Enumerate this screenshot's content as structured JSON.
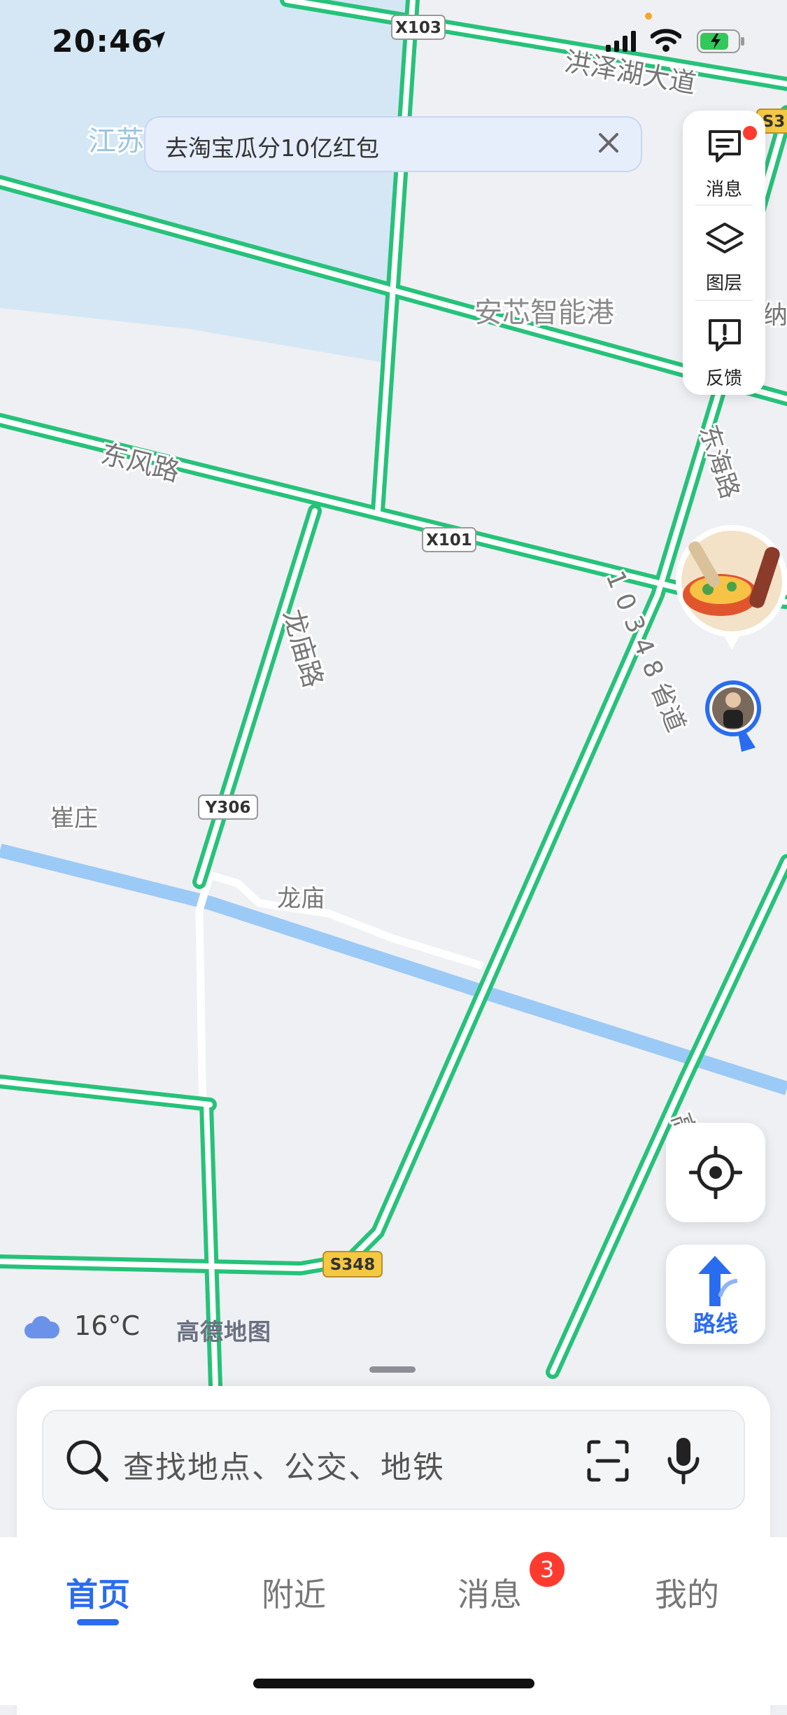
{
  "status_bar": {
    "time": "20:46"
  },
  "banner": {
    "text": "去淘宝瓜分10亿红包"
  },
  "side_panel": {
    "messages": "消息",
    "layers": "图层",
    "feedback": "反馈"
  },
  "map": {
    "labels": {
      "jiangsu": "江苏",
      "hongzehu": "洪泽湖大道",
      "anxin": "安芯智能港",
      "dongfeng": "东风路",
      "donghai": "东海路",
      "longmiao_road": "龙庙路",
      "provincial": "1 0 3 4 8 省道",
      "cuizhuang": "崔庄",
      "longmiao": "龙庙",
      "highway": "高速",
      "edge_fragment": "纳东"
    },
    "shields": {
      "x103": "X103",
      "x101": "X101",
      "y306": "Y306",
      "s348": "S348",
      "s3": "S3"
    }
  },
  "route_button": {
    "label": "路线"
  },
  "weather": {
    "temp": "16°C",
    "logo": "高德地图"
  },
  "search": {
    "placeholder": "查找地点、公交、地铁"
  },
  "tabs": {
    "home": "首页",
    "nearby": "附近",
    "messages": "消息",
    "mine": "我的",
    "badge": "3"
  }
}
